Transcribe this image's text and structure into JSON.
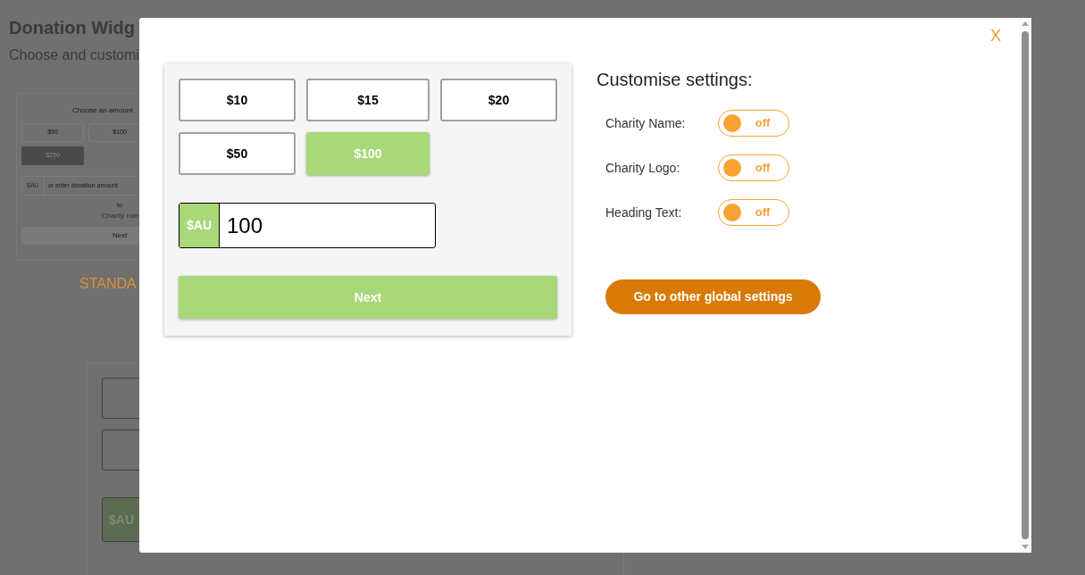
{
  "background_page": {
    "title": "Donation Widg",
    "subtitle": "Choose and customi",
    "preview": {
      "heading": "Choose an amount",
      "amounts": [
        {
          "label": "$50",
          "selected": false
        },
        {
          "label": "$100",
          "selected": false
        },
        {
          "label": "$250",
          "selected": true
        }
      ],
      "currency": "$AU",
      "placeholder": "or enter donation amount",
      "to_text": "to",
      "charity": "Charity nam",
      "next": "Next"
    },
    "style_label": "STANDA",
    "second_preview": {
      "currency": "$AU"
    }
  },
  "modal": {
    "close": "X",
    "widget": {
      "amounts": [
        {
          "label": "$10",
          "selected": false
        },
        {
          "label": "$15",
          "selected": false
        },
        {
          "label": "$20",
          "selected": false
        },
        {
          "label": "$50",
          "selected": false
        },
        {
          "label": "$100",
          "selected": true
        }
      ],
      "currency": "$AU",
      "amount": "100",
      "next": "Next"
    },
    "settings": {
      "title": "Customise settings:",
      "toggles": [
        {
          "label": "Charity Name:",
          "on": false,
          "state_text": "off"
        },
        {
          "label": "Charity Logo:",
          "on": false,
          "state_text": "off"
        },
        {
          "label": "Heading Text:",
          "on": false,
          "state_text": "off"
        }
      ],
      "global_button": "Go to other global settings"
    }
  }
}
